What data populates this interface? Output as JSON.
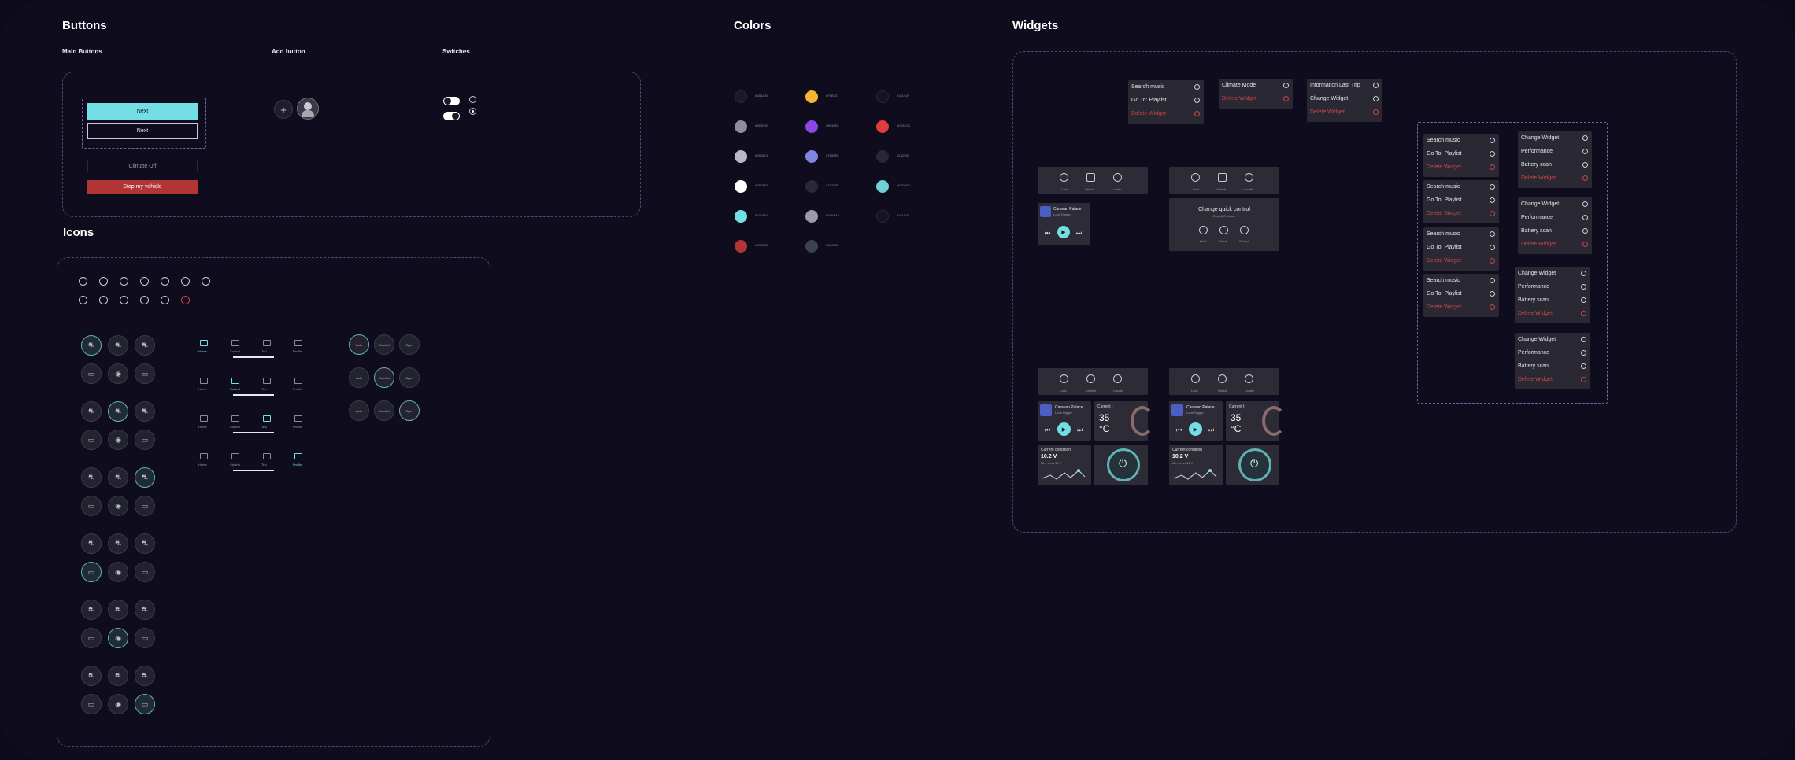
{
  "sections": {
    "buttons": "Buttons",
    "icons": "Icons",
    "colors": "Colors",
    "widgets": "Widgets"
  },
  "buttons": {
    "main_label": "Main Buttons",
    "add_label": "Add button",
    "switches_label": "Switches",
    "next_primary": "Next",
    "next_outline": "Next",
    "climate_off": "Climate Off",
    "stop_vehicle": "Stop my vehicle",
    "add_symbol": "+"
  },
  "colors": {
    "swatches": [
      {
        "hex": "#1b1a26",
        "label": "#1B1A26"
      },
      {
        "hex": "#f5b731",
        "label": "#F5B731"
      },
      {
        "hex": "#15141f",
        "label": "#15141F"
      },
      {
        "hex": "#8e8d9c",
        "label": "#8E8D9C"
      },
      {
        "hex": "#8b46e6",
        "label": "#8B46E6"
      },
      {
        "hex": "#e03c3c",
        "label": "#E03C3C"
      },
      {
        "hex": "#b9b8c6",
        "label": "#B9B8C6"
      },
      {
        "hex": "#7e86e0",
        "label": "#7E86E0"
      },
      {
        "hex": "#2a2933",
        "label": "#2A2933"
      },
      {
        "hex": "#ffffff",
        "label": "#FFFFFF"
      },
      {
        "hex": "#2a2935",
        "label": "#2A2935"
      },
      {
        "hex": "#6fd0d6",
        "label": "#6FD0D6"
      },
      {
        "hex": "#73dee4",
        "label": "#73DEE4"
      },
      {
        "hex": "#9a9aa8",
        "label": "#9A9AA8"
      },
      {
        "hex": "#16151f",
        "label": "#16151F"
      },
      {
        "hex": "#b13535",
        "label": "#B13535"
      },
      {
        "hex": "#3a4450",
        "label": "#3A4450"
      }
    ]
  },
  "icons": {
    "nav_labels": [
      "Home",
      "Control",
      "Trip",
      "Profile"
    ],
    "mode_labels": [
      "Auto",
      "Comfort",
      "Sport"
    ]
  },
  "widgets": {
    "menu_a": [
      "Search music",
      "Go To: Playlist",
      "Delete Widget"
    ],
    "menu_b": [
      "Climate Mode",
      "Delete Widget"
    ],
    "menu_c": [
      "Information Last Trip",
      "Change Widget",
      "Delete Widget"
    ],
    "menu_d": [
      "Change Widget",
      "Performance",
      "Battery scan",
      "Delete Widget"
    ],
    "quick_labels": [
      "Lock",
      "Unlock",
      "Locate"
    ],
    "song_title": "Caravan Palace",
    "song_artist": "Lone Digger",
    "change_quick": "Change quick control",
    "change_quick_sub": "Drag & Release",
    "quick_labels2": [
      "Heat",
      "Wind",
      "Sound"
    ],
    "current_label": "Current t",
    "temp_value": "35",
    "temp_unit": "°C",
    "cond_label": "Current condition",
    "volt_value": "10.2 V",
    "volt_sub": "Min. level 12 V"
  }
}
